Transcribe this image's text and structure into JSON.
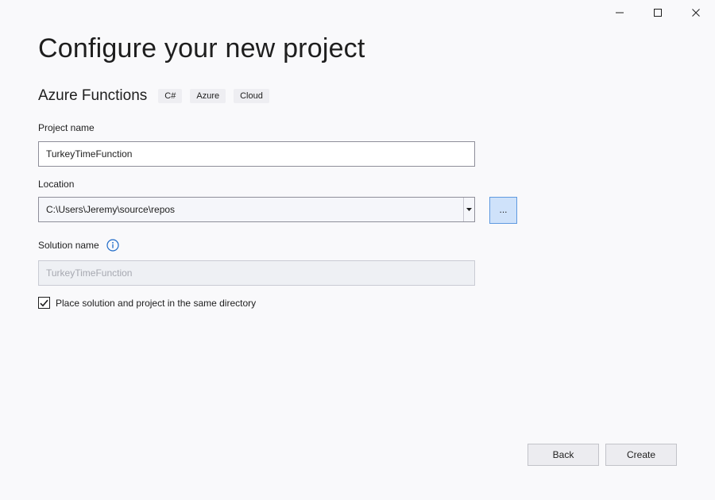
{
  "window": {
    "controls": [
      {
        "name": "minimize-icon"
      },
      {
        "name": "maximize-icon"
      },
      {
        "name": "close-icon"
      }
    ]
  },
  "page": {
    "title": "Configure your new project"
  },
  "template": {
    "name": "Azure Functions",
    "tags": [
      "C#",
      "Azure",
      "Cloud"
    ]
  },
  "project_name": {
    "label": "Project name",
    "value": "TurkeyTimeFunction"
  },
  "location": {
    "label": "Location",
    "value": "C:\\Users\\Jeremy\\source\\repos",
    "browse_label": "..."
  },
  "solution_name": {
    "label": "Solution name",
    "value": "TurkeyTimeFunction",
    "info_icon": "info-icon"
  },
  "same_directory": {
    "label": "Place solution and project in the same directory",
    "checked": true
  },
  "footer": {
    "back_label": "Back",
    "create_label": "Create"
  },
  "colors": {
    "background": "#f9f9fb",
    "accent": "#1e6ac8",
    "browse_bg": "#cfe2fa"
  }
}
